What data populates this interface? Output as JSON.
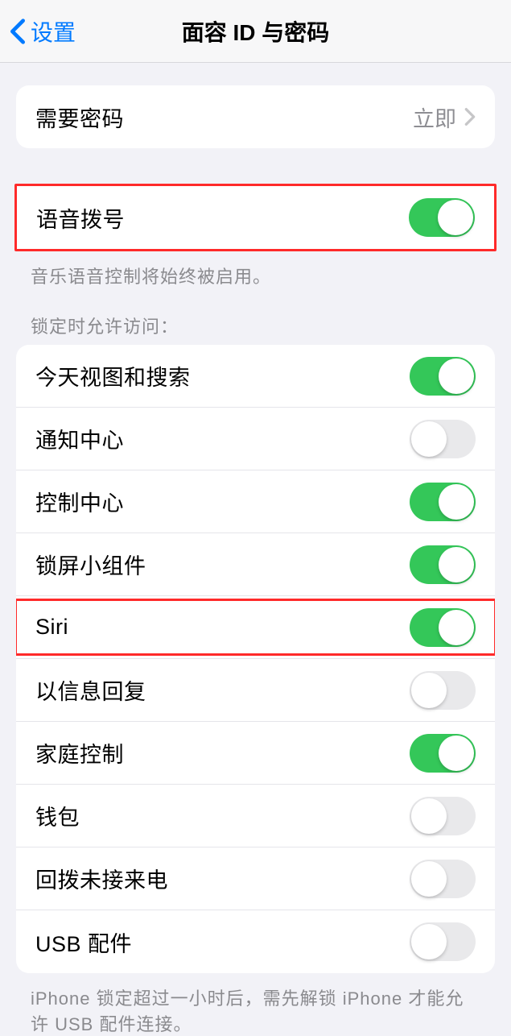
{
  "nav": {
    "back_label": "设置",
    "title": "面容 ID 与密码"
  },
  "require_passcode": {
    "label": "需要密码",
    "value": "立即"
  },
  "voice_dial": {
    "label": "语音拨号",
    "on": true,
    "footer": "音乐语音控制将始终被启用。"
  },
  "lock_access": {
    "header": "锁定时允许访问：",
    "items": [
      {
        "label": "今天视图和搜索",
        "on": true
      },
      {
        "label": "通知中心",
        "on": false
      },
      {
        "label": "控制中心",
        "on": true
      },
      {
        "label": "锁屏小组件",
        "on": true
      },
      {
        "label": "Siri",
        "on": true
      },
      {
        "label": "以信息回复",
        "on": false
      },
      {
        "label": "家庭控制",
        "on": true
      },
      {
        "label": "钱包",
        "on": false
      },
      {
        "label": "回拨未接来电",
        "on": false
      },
      {
        "label": "USB 配件",
        "on": false
      }
    ],
    "footer": "iPhone 锁定超过一小时后，需先解锁 iPhone 才能允许 USB 配件连接。"
  }
}
